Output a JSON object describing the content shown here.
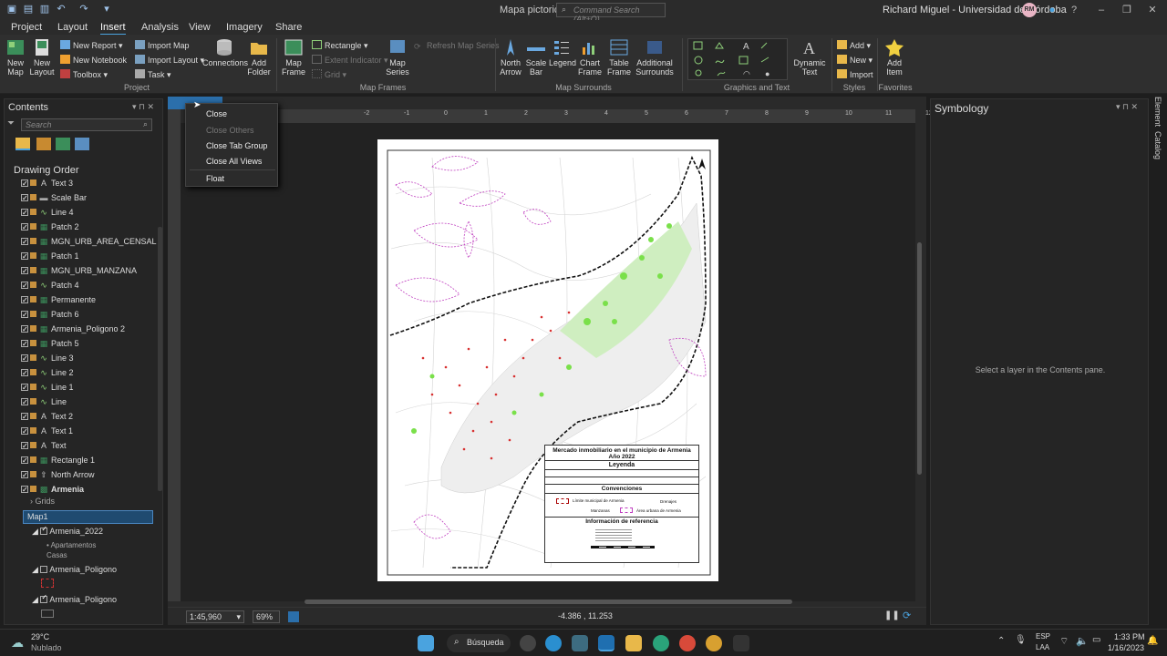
{
  "app": {
    "title": "Mapa pictorico",
    "command_search_placeholder": "Command Search (Alt+Q)",
    "user": "Richard Miguel - Universidad de Córdoba",
    "avatar": "RM"
  },
  "ribbon_tabs": [
    "Project",
    "Layout",
    "Insert",
    "Analysis",
    "View",
    "Imagery",
    "Share"
  ],
  "active_tab": "Insert",
  "ribbon": {
    "project": {
      "label": "Project",
      "new_map": "New Map",
      "new_layout": "New Layout",
      "new_report": "New Report",
      "new_notebook": "New Notebook",
      "toolbox": "Toolbox",
      "import_map": "Import Map",
      "import_layout": "Import Layout",
      "task": "Task",
      "connections": "Connections",
      "add_folder": "Add Folder"
    },
    "map_frames": {
      "label": "Map Frames",
      "map_frame": "Map Frame",
      "rectangle": "Rectangle",
      "extent_indicator": "Extent Indicator",
      "grid": "Grid",
      "map_series": "Map Series",
      "refresh_map_series": "Refresh Map Series"
    },
    "map_surrounds": {
      "label": "Map Surrounds",
      "north_arrow": "North Arrow",
      "scale_bar": "Scale Bar",
      "legend": "Legend",
      "chart_frame": "Chart Frame",
      "table_frame": "Table Frame",
      "additional_surrounds": "Additional Surrounds"
    },
    "graphics_text": {
      "label": "Graphics and Text",
      "dynamic_text": "Dynamic Text"
    },
    "styles": {
      "label": "Styles",
      "add": "Add",
      "new": "New",
      "import": "Import"
    },
    "favorites": {
      "label": "Favorites",
      "add_item": "Add Item"
    }
  },
  "contents": {
    "title": "Contents",
    "search_placeholder": "Search",
    "drawing_order": "Drawing Order",
    "items": [
      {
        "label": "Text 3",
        "type": "text"
      },
      {
        "label": "Scale Bar",
        "type": "scale"
      },
      {
        "label": "Line 4",
        "type": "line"
      },
      {
        "label": "Patch 2",
        "type": "patch"
      },
      {
        "label": "MGN_URB_AREA_CENSAL",
        "type": "patch"
      },
      {
        "label": "Patch 1",
        "type": "patch"
      },
      {
        "label": "MGN_URB_MANZANA",
        "type": "patch"
      },
      {
        "label": "Patch 4",
        "type": "line"
      },
      {
        "label": "Permanente",
        "type": "patch"
      },
      {
        "label": "Patch 6",
        "type": "patch"
      },
      {
        "label": "Armenia_Poligono 2",
        "type": "patch"
      },
      {
        "label": "Patch 5",
        "type": "patch"
      },
      {
        "label": "Line 3",
        "type": "line"
      },
      {
        "label": "Line 2",
        "type": "line"
      },
      {
        "label": "Line 1",
        "type": "line"
      },
      {
        "label": "Line",
        "type": "line"
      },
      {
        "label": "Text 2",
        "type": "text"
      },
      {
        "label": "Text 1",
        "type": "text"
      },
      {
        "label": "Text",
        "type": "text"
      },
      {
        "label": "Rectangle 1",
        "type": "patch"
      },
      {
        "label": "North Arrow",
        "type": "north"
      },
      {
        "label": "Armenia",
        "type": "frame"
      }
    ],
    "sub_items": {
      "grids": "Grids",
      "map1": "Map1",
      "armenia_2022": "Armenia_2022",
      "apartamentos": "Apartamentos",
      "casas": "Casas",
      "armenia_poligono_a": "Armenia_Poligono",
      "armenia_poligono_b": "Armenia_Poligono"
    }
  },
  "context_menu": {
    "items": [
      {
        "label": "Close",
        "enabled": true
      },
      {
        "label": "Close Others",
        "enabled": false
      },
      {
        "label": "Close Tab Group",
        "enabled": true
      },
      {
        "label": "Close All Views",
        "enabled": true
      },
      {
        "label": "Float",
        "enabled": true
      }
    ]
  },
  "layout": {
    "title_line1": "Mercado inmobiliario en el municipio de Armenia",
    "title_line2": "Año 2022",
    "leyenda": "Leyenda",
    "convenciones": "Convenciones",
    "limite": "Límite municipal de Armenia",
    "drenajes": "Drenajes",
    "manzanas": "Manzanas",
    "area_urbana": "Área urbana de Armenia",
    "info_ref": "Información de referencia"
  },
  "status": {
    "scale": "1:45,960",
    "zoom": "69%",
    "coords": "-4.386 , 11.253"
  },
  "symbology": {
    "title": "Symbology",
    "message": "Select a layer in the Contents pane."
  },
  "side_tabs": [
    "Element",
    "Catalog"
  ],
  "taskbar": {
    "temp": "29°C",
    "weather": "Nublado",
    "search": "Búsqueda",
    "lang": "ESP",
    "lang2": "LAA",
    "time": "1:33 PM",
    "date": "1/16/2023"
  }
}
